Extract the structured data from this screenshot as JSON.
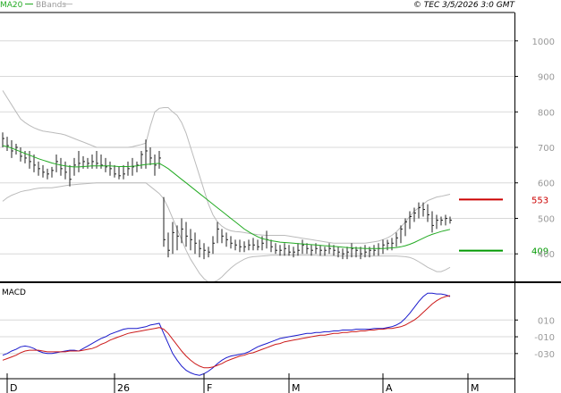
{
  "legend": {
    "ma20": "MA20",
    "bbands": "BBands",
    "copyright": "© TEC 3/5/2026 3:0 GMT"
  },
  "colors": {
    "price": "#222222",
    "ma20": "#22aa22",
    "bbands": "#bbbbbb",
    "resistance": "#cc0000",
    "support": "#009900",
    "macd": "#1a1acc",
    "signal": "#cc1a1a",
    "grid": "#d8d8d8",
    "frame": "#000000"
  },
  "chart_data": [
    {
      "type": "line",
      "name": "price-panel",
      "ylim": [
        320,
        1080
      ],
      "y_ticks": [
        400,
        500,
        600,
        700,
        800,
        900,
        1000
      ],
      "x_labels": [
        {
          "index": 1,
          "label": "D"
        },
        {
          "index": 25,
          "label": "26"
        },
        {
          "index": 45,
          "label": "F"
        },
        {
          "index": 64,
          "label": "M"
        },
        {
          "index": 85,
          "label": "A"
        },
        {
          "index": 104,
          "label": "M"
        }
      ],
      "price_bars": [
        {
          "h": 742,
          "l": 700,
          "c": 725
        },
        {
          "h": 730,
          "l": 690,
          "c": 705
        },
        {
          "h": 720,
          "l": 670,
          "c": 690
        },
        {
          "h": 710,
          "l": 680,
          "c": 700
        },
        {
          "h": 700,
          "l": 660,
          "c": 675
        },
        {
          "h": 690,
          "l": 655,
          "c": 670
        },
        {
          "h": 690,
          "l": 640,
          "c": 660
        },
        {
          "h": 680,
          "l": 630,
          "c": 650
        },
        {
          "h": 660,
          "l": 620,
          "c": 640
        },
        {
          "h": 650,
          "l": 615,
          "c": 630
        },
        {
          "h": 640,
          "l": 610,
          "c": 625
        },
        {
          "h": 645,
          "l": 615,
          "c": 635
        },
        {
          "h": 680,
          "l": 630,
          "c": 660
        },
        {
          "h": 670,
          "l": 620,
          "c": 640
        },
        {
          "h": 660,
          "l": 610,
          "c": 630
        },
        {
          "h": 650,
          "l": 590,
          "c": 610
        },
        {
          "h": 670,
          "l": 620,
          "c": 650
        },
        {
          "h": 690,
          "l": 630,
          "c": 655
        },
        {
          "h": 675,
          "l": 640,
          "c": 660
        },
        {
          "h": 670,
          "l": 640,
          "c": 655
        },
        {
          "h": 680,
          "l": 640,
          "c": 660
        },
        {
          "h": 690,
          "l": 640,
          "c": 655
        },
        {
          "h": 680,
          "l": 640,
          "c": 650
        },
        {
          "h": 670,
          "l": 630,
          "c": 645
        },
        {
          "h": 660,
          "l": 620,
          "c": 640
        },
        {
          "h": 650,
          "l": 615,
          "c": 625
        },
        {
          "h": 645,
          "l": 610,
          "c": 620
        },
        {
          "h": 650,
          "l": 610,
          "c": 625
        },
        {
          "h": 660,
          "l": 620,
          "c": 640
        },
        {
          "h": 670,
          "l": 620,
          "c": 645
        },
        {
          "h": 660,
          "l": 630,
          "c": 650
        },
        {
          "h": 690,
          "l": 640,
          "c": 680
        },
        {
          "h": 722,
          "l": 640,
          "c": 690
        },
        {
          "h": 700,
          "l": 650,
          "c": 670
        },
        {
          "h": 680,
          "l": 620,
          "c": 650
        },
        {
          "h": 690,
          "l": 640,
          "c": 670
        },
        {
          "h": 560,
          "l": 420,
          "c": 440
        },
        {
          "h": 460,
          "l": 390,
          "c": 410
        },
        {
          "h": 490,
          "l": 400,
          "c": 460
        },
        {
          "h": 480,
          "l": 410,
          "c": 450
        },
        {
          "h": 500,
          "l": 430,
          "c": 470
        },
        {
          "h": 490,
          "l": 420,
          "c": 450
        },
        {
          "h": 470,
          "l": 410,
          "c": 440
        },
        {
          "h": 460,
          "l": 400,
          "c": 430
        },
        {
          "h": 440,
          "l": 390,
          "c": 415
        },
        {
          "h": 430,
          "l": 385,
          "c": 410
        },
        {
          "h": 420,
          "l": 390,
          "c": 405
        },
        {
          "h": 450,
          "l": 400,
          "c": 430
        },
        {
          "h": 490,
          "l": 430,
          "c": 470
        },
        {
          "h": 470,
          "l": 430,
          "c": 450
        },
        {
          "h": 460,
          "l": 420,
          "c": 440
        },
        {
          "h": 450,
          "l": 415,
          "c": 430
        },
        {
          "h": 440,
          "l": 410,
          "c": 425
        },
        {
          "h": 440,
          "l": 405,
          "c": 420
        },
        {
          "h": 435,
          "l": 405,
          "c": 420
        },
        {
          "h": 440,
          "l": 410,
          "c": 425
        },
        {
          "h": 445,
          "l": 410,
          "c": 425
        },
        {
          "h": 440,
          "l": 410,
          "c": 420
        },
        {
          "h": 450,
          "l": 410,
          "c": 430
        },
        {
          "h": 465,
          "l": 415,
          "c": 440
        },
        {
          "h": 440,
          "l": 405,
          "c": 420
        },
        {
          "h": 430,
          "l": 400,
          "c": 410
        },
        {
          "h": 425,
          "l": 395,
          "c": 410
        },
        {
          "h": 430,
          "l": 395,
          "c": 415
        },
        {
          "h": 425,
          "l": 395,
          "c": 405
        },
        {
          "h": 420,
          "l": 390,
          "c": 405
        },
        {
          "h": 430,
          "l": 395,
          "c": 410
        },
        {
          "h": 440,
          "l": 400,
          "c": 425
        },
        {
          "h": 430,
          "l": 400,
          "c": 415
        },
        {
          "h": 425,
          "l": 395,
          "c": 410
        },
        {
          "h": 430,
          "l": 400,
          "c": 415
        },
        {
          "h": 425,
          "l": 395,
          "c": 410
        },
        {
          "h": 420,
          "l": 395,
          "c": 410
        },
        {
          "h": 430,
          "l": 400,
          "c": 415
        },
        {
          "h": 425,
          "l": 395,
          "c": 410
        },
        {
          "h": 420,
          "l": 390,
          "c": 405
        },
        {
          "h": 415,
          "l": 385,
          "c": 400
        },
        {
          "h": 420,
          "l": 385,
          "c": 405
        },
        {
          "h": 430,
          "l": 390,
          "c": 415
        },
        {
          "h": 420,
          "l": 390,
          "c": 410
        },
        {
          "h": 420,
          "l": 385,
          "c": 400
        },
        {
          "h": 425,
          "l": 390,
          "c": 405
        },
        {
          "h": 420,
          "l": 390,
          "c": 410
        },
        {
          "h": 425,
          "l": 395,
          "c": 410
        },
        {
          "h": 430,
          "l": 395,
          "c": 415
        },
        {
          "h": 440,
          "l": 400,
          "c": 425
        },
        {
          "h": 440,
          "l": 410,
          "c": 430
        },
        {
          "h": 445,
          "l": 410,
          "c": 430
        },
        {
          "h": 460,
          "l": 420,
          "c": 445
        },
        {
          "h": 480,
          "l": 430,
          "c": 470
        },
        {
          "h": 500,
          "l": 450,
          "c": 490
        },
        {
          "h": 520,
          "l": 470,
          "c": 505
        },
        {
          "h": 530,
          "l": 490,
          "c": 515
        },
        {
          "h": 545,
          "l": 500,
          "c": 530
        },
        {
          "h": 545,
          "l": 505,
          "c": 525
        },
        {
          "h": 540,
          "l": 490,
          "c": 510
        },
        {
          "h": 520,
          "l": 460,
          "c": 480
        },
        {
          "h": 510,
          "l": 470,
          "c": 495
        },
        {
          "h": 505,
          "l": 480,
          "c": 495
        },
        {
          "h": 510,
          "l": 480,
          "c": 500
        },
        {
          "h": 505,
          "l": 485,
          "c": 495
        }
      ],
      "ma20": [
        705,
        702,
        698,
        693,
        688,
        683,
        678,
        673,
        668,
        664,
        660,
        656,
        653,
        650,
        648,
        646,
        645,
        645,
        646,
        647,
        648,
        648,
        648,
        648,
        648,
        647,
        646,
        646,
        646,
        647,
        648,
        650,
        652,
        653,
        654,
        655,
        648,
        640,
        630,
        620,
        610,
        600,
        590,
        580,
        570,
        560,
        550,
        540,
        530,
        520,
        510,
        500,
        490,
        480,
        470,
        462,
        455,
        448,
        443,
        440,
        437,
        435,
        433,
        432,
        431,
        430,
        429,
        428,
        427,
        426,
        425,
        424,
        423,
        422,
        421,
        420,
        419,
        418,
        417,
        416,
        416,
        415,
        415,
        415,
        415,
        415,
        416,
        417,
        418,
        420,
        423,
        427,
        432,
        438,
        444,
        450,
        455,
        459,
        463,
        466,
        469
      ],
      "bb_upper": [
        860,
        840,
        820,
        800,
        780,
        770,
        762,
        755,
        750,
        746,
        744,
        742,
        740,
        738,
        735,
        730,
        725,
        720,
        715,
        710,
        705,
        700,
        700,
        700,
        700,
        700,
        700,
        700,
        700,
        702,
        705,
        708,
        712,
        760,
        800,
        810,
        812,
        812,
        800,
        790,
        770,
        740,
        700,
        660,
        620,
        580,
        540,
        510,
        490,
        478,
        470,
        465,
        463,
        462,
        460,
        458,
        456,
        454,
        453,
        452,
        452,
        452,
        452,
        452,
        450,
        448,
        446,
        444,
        442,
        440,
        438,
        436,
        434,
        432,
        430,
        430,
        430,
        430,
        430,
        430,
        430,
        430,
        432,
        434,
        436,
        440,
        445,
        452,
        462,
        475,
        490,
        505,
        520,
        530,
        540,
        550,
        555,
        560,
        562,
        565,
        568
      ],
      "bb_lower": [
        548,
        558,
        565,
        570,
        575,
        578,
        580,
        583,
        585,
        586,
        586,
        586,
        588,
        590,
        592,
        594,
        595,
        596,
        597,
        598,
        599,
        600,
        600,
        600,
        600,
        600,
        600,
        600,
        600,
        600,
        600,
        600,
        600,
        590,
        580,
        570,
        555,
        530,
        500,
        470,
        440,
        410,
        385,
        365,
        345,
        330,
        320,
        320,
        325,
        335,
        348,
        360,
        370,
        378,
        385,
        390,
        392,
        393,
        394,
        395,
        396,
        396,
        396,
        396,
        396,
        396,
        396,
        396,
        396,
        396,
        396,
        395,
        395,
        395,
        395,
        394,
        394,
        394,
        394,
        394,
        394,
        394,
        394,
        394,
        394,
        394,
        394,
        394,
        394,
        393,
        392,
        390,
        385,
        378,
        370,
        362,
        356,
        350,
        350,
        355,
        362
      ],
      "levels": [
        {
          "value": 553,
          "label": "553",
          "kind": "resistance"
        },
        {
          "value": 409,
          "label": "409",
          "kind": "support"
        }
      ]
    },
    {
      "type": "line",
      "name": "macd-panel",
      "title": "MACD",
      "ylim": [
        -60,
        55
      ],
      "y_ticks": [
        {
          "value": 10,
          "label": "010"
        },
        {
          "value": -10,
          "label": "-010"
        },
        {
          "value": -30,
          "label": "-030"
        }
      ],
      "series": [
        {
          "name": "MACD",
          "values": [
            -32,
            -30,
            -27,
            -25,
            -22,
            -21,
            -22,
            -24,
            -27,
            -29,
            -30,
            -30,
            -29,
            -28,
            -27,
            -26,
            -26,
            -27,
            -24,
            -21,
            -18,
            -15,
            -12,
            -10,
            -7,
            -5,
            -3,
            -1,
            0,
            0,
            0,
            1,
            2,
            4,
            5,
            6,
            -6,
            -18,
            -30,
            -38,
            -45,
            -50,
            -53,
            -55,
            -56,
            -54,
            -51,
            -47,
            -42,
            -38,
            -35,
            -33,
            -32,
            -31,
            -30,
            -28,
            -25,
            -22,
            -20,
            -18,
            -16,
            -14,
            -12,
            -11,
            -10,
            -9,
            -8,
            -7,
            -6,
            -6,
            -5,
            -5,
            -4,
            -4,
            -3,
            -3,
            -2,
            -2,
            -2,
            -1,
            -1,
            -1,
            -1,
            0,
            0,
            0,
            1,
            2,
            4,
            7,
            12,
            18,
            25,
            32,
            38,
            42,
            42,
            41,
            41,
            40,
            38
          ]
        },
        {
          "name": "Signal",
          "values": [
            -38,
            -36,
            -34,
            -32,
            -29,
            -27,
            -26,
            -26,
            -26,
            -27,
            -28,
            -28,
            -28,
            -28,
            -28,
            -27,
            -27,
            -27,
            -26,
            -25,
            -24,
            -22,
            -19,
            -17,
            -14,
            -12,
            -10,
            -8,
            -6,
            -5,
            -4,
            -3,
            -2,
            -1,
            0,
            1,
            -1,
            -6,
            -13,
            -20,
            -27,
            -33,
            -38,
            -42,
            -45,
            -47,
            -47,
            -46,
            -44,
            -42,
            -39,
            -37,
            -35,
            -33,
            -32,
            -30,
            -29,
            -27,
            -25,
            -23,
            -21,
            -19,
            -18,
            -16,
            -15,
            -14,
            -13,
            -12,
            -11,
            -10,
            -9,
            -8,
            -8,
            -7,
            -6,
            -6,
            -5,
            -5,
            -4,
            -4,
            -3,
            -3,
            -2,
            -2,
            -1,
            -1,
            0,
            0,
            1,
            2,
            4,
            7,
            10,
            14,
            19,
            24,
            29,
            33,
            36,
            38,
            39
          ]
        }
      ]
    }
  ]
}
